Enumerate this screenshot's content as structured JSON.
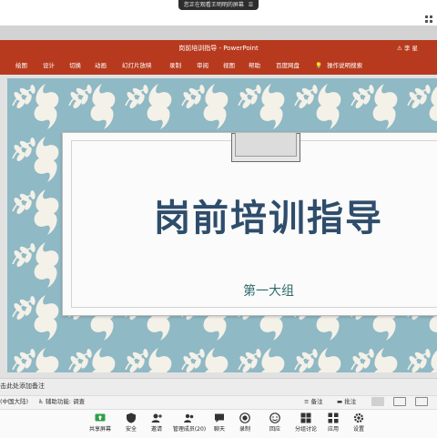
{
  "meeting": {
    "share_notice": "您正在观看王明明的屏幕",
    "toolbar": [
      {
        "label": "共享屏幕",
        "icon": "screen-share-icon"
      },
      {
        "label": "安全",
        "icon": "shield-icon"
      },
      {
        "label": "邀请",
        "icon": "invite-icon"
      },
      {
        "label": "管理成员(20)",
        "icon": "participants-icon"
      },
      {
        "label": "聊天",
        "icon": "chat-icon"
      },
      {
        "label": "录制",
        "icon": "record-icon"
      },
      {
        "label": "回应",
        "icon": "reaction-icon"
      },
      {
        "label": "分组讨论",
        "icon": "breakout-icon"
      },
      {
        "label": "应用",
        "icon": "apps-icon"
      },
      {
        "label": "设置",
        "icon": "gear-icon"
      }
    ]
  },
  "ppt": {
    "window_title": "岗前培训指导 - PowerPoint",
    "user_name": "李 星",
    "tabs": [
      "绘图",
      "设计",
      "切换",
      "动画",
      "幻灯片放映",
      "录制",
      "审阅",
      "视图",
      "帮助",
      "百度网盘"
    ],
    "tell_me": "操作说明搜索",
    "slide": {
      "title": "岗前培训指导",
      "subtitle": "第一大组"
    },
    "notes_placeholder": "击此处添加备注",
    "status": {
      "language": "(中国大陆)",
      "accessibility": "辅助功能: 调查",
      "notes_btn": "备注",
      "comments_btn": "批注"
    }
  },
  "colors": {
    "ribbon": "#b73a1f",
    "slide_bg": "#8fb9c4",
    "title_text": "#2e4d6b",
    "subtitle_text": "#2e6b6a"
  }
}
